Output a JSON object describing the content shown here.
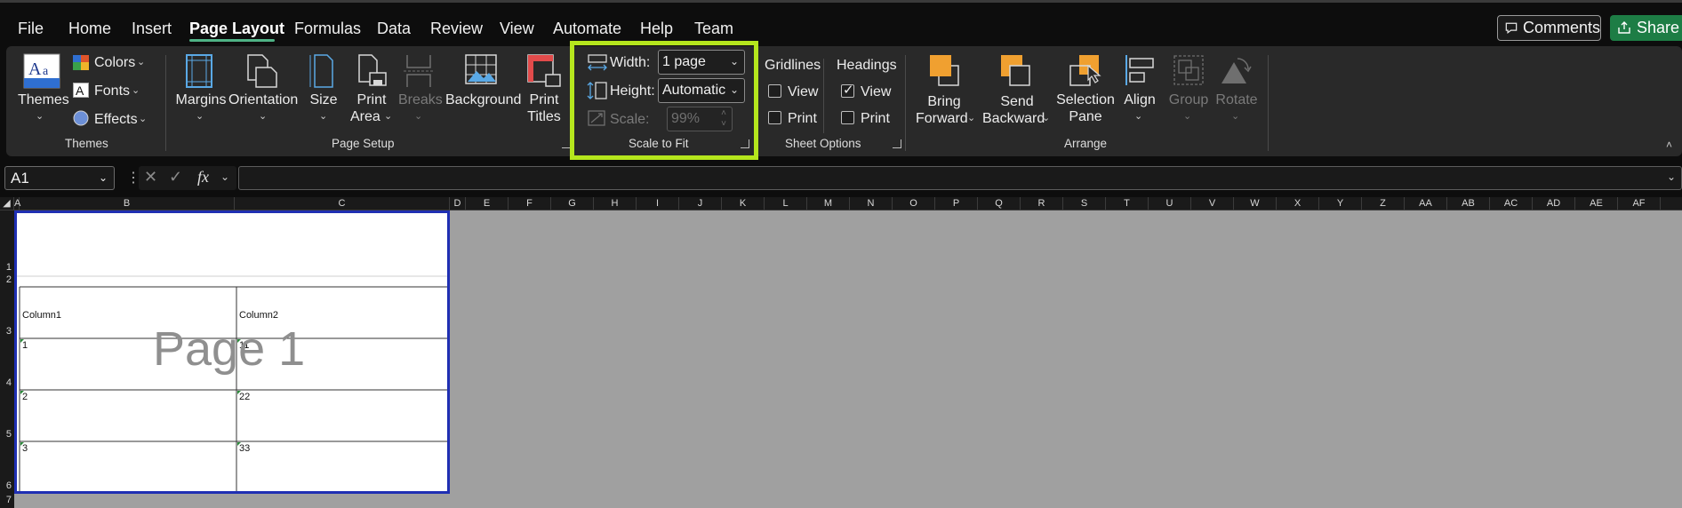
{
  "menu": {
    "items": [
      "File",
      "Home",
      "Insert",
      "Page Layout",
      "Formulas",
      "Data",
      "Review",
      "View",
      "Automate",
      "Help",
      "Team"
    ],
    "active": "Page Layout",
    "comments_label": "Comments",
    "share_label": "Share"
  },
  "ribbon": {
    "themes_group": {
      "themes_label": "Themes",
      "colors_label": "Colors",
      "fonts_label": "Fonts",
      "effects_label": "Effects",
      "group_label": "Themes"
    },
    "page_setup": {
      "margins_label": "Margins",
      "orientation_label": "Orientation",
      "size_label": "Size",
      "print_area_line1": "Print",
      "print_area_line2": "Area",
      "breaks_label": "Breaks",
      "background_label": "Background",
      "print_titles_line1": "Print",
      "print_titles_line2": "Titles",
      "group_label": "Page Setup"
    },
    "scale_to_fit": {
      "width_label": "Width:",
      "width_value": "1 page",
      "height_label": "Height:",
      "height_value": "Automatic",
      "scale_label": "Scale:",
      "scale_value": "99%",
      "group_label": "Scale to Fit"
    },
    "sheet_options": {
      "gridlines_label": "Gridlines",
      "headings_label": "Headings",
      "gridlines_view_label": "View",
      "gridlines_print_label": "Print",
      "headings_view_label": "View",
      "headings_print_label": "Print",
      "gridlines_view_checked": false,
      "gridlines_print_checked": false,
      "headings_view_checked": true,
      "headings_print_checked": false,
      "group_label": "Sheet Options"
    },
    "arrange": {
      "bring_forward_line1": "Bring",
      "bring_forward_line2": "Forward",
      "send_backward_line1": "Send",
      "send_backward_line2": "Backward",
      "selection_pane_line1": "Selection",
      "selection_pane_line2": "Pane",
      "align_label": "Align",
      "group_label_btn": "Group",
      "rotate_label": "Rotate",
      "group_label": "Arrange"
    }
  },
  "formula_bar": {
    "name_box": "A1",
    "fx_label": "fx",
    "formula": ""
  },
  "sheet": {
    "columns": [
      "A",
      "B",
      "C",
      "D",
      "E",
      "F",
      "G",
      "H",
      "I",
      "J",
      "K",
      "L",
      "M",
      "N",
      "O",
      "P",
      "Q",
      "R",
      "S",
      "T",
      "U",
      "V",
      "W",
      "X",
      "Y",
      "Z",
      "AA",
      "AB",
      "AC",
      "AD",
      "AE",
      "AF"
    ],
    "rows": [
      "1",
      "2",
      "3",
      "4",
      "5",
      "6",
      "7"
    ],
    "table": {
      "headers": [
        "Column1",
        "Column2"
      ],
      "cells": [
        [
          "1",
          "11"
        ],
        [
          "2",
          "22"
        ],
        [
          "3",
          "33"
        ]
      ]
    },
    "page_watermark": "Page 1"
  },
  "colors": {
    "accent_green": "#4fb386",
    "highlight": "#b5e61d",
    "share_bg": "#1d7d45",
    "page_border": "#1f2fb3"
  }
}
